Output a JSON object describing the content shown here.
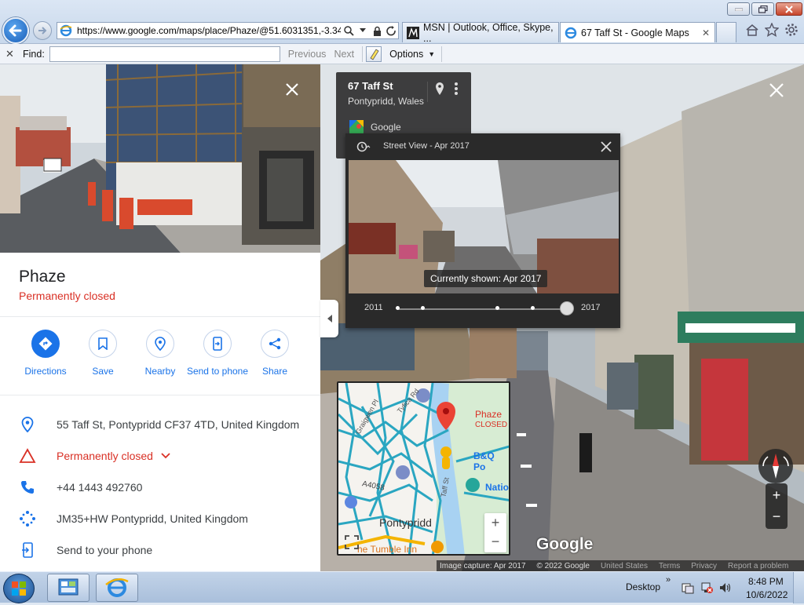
{
  "browser": {
    "address_url": "https://www.google.com/maps/place/Phaze/@51.6031351,-3.34",
    "tabs": [
      {
        "label": "MSN | Outlook, Office, Skype, ..."
      },
      {
        "label": "67 Taff St - Google Maps"
      }
    ],
    "find": {
      "label": "Find:",
      "value": "",
      "previous": "Previous",
      "next": "Next",
      "options": "Options"
    }
  },
  "place": {
    "name": "Phaze",
    "status": "Permanently closed",
    "actions": [
      {
        "label": "Directions",
        "icon": "directions-icon"
      },
      {
        "label": "Save",
        "icon": "bookmark-icon"
      },
      {
        "label": "Nearby",
        "icon": "nearby-icon"
      },
      {
        "label": "Send to phone",
        "icon": "send-to-phone-icon"
      },
      {
        "label": "Share",
        "icon": "share-icon"
      }
    ],
    "details": {
      "address": "55 Taff St, Pontypridd CF37 4TD, United Kingdom",
      "status": "Permanently closed",
      "phone": "+44 1443 492760",
      "plus_code": "JM35+HW Pontypridd, United Kingdom",
      "send_to_phone": "Send to your phone"
    }
  },
  "street_view": {
    "card": {
      "address": "67 Taff St",
      "city": "Pontypridd, Wales",
      "provider": "Google"
    },
    "time_machine": {
      "title": "Street View - Apr 2017",
      "tooltip": "Currently shown: Apr 2017",
      "start_year": "2011",
      "end_year": "2017"
    },
    "minimap": {
      "place": "Phaze",
      "place_status": "CLOSED",
      "town": "Pontypridd",
      "poi_1": "B&Q Po",
      "poi_2": "Natio",
      "road": "A4058",
      "pub": "he Tumble Inn",
      "street_1": "Tyfica Rd",
      "street_2": "Graigwen Pl",
      "street_3": "Taff St"
    },
    "watermark": "Google",
    "footer": {
      "capture": "Image capture: Apr 2017",
      "copyright": "© 2022 Google",
      "country": "United States",
      "terms": "Terms",
      "privacy": "Privacy",
      "report": "Report a problem"
    }
  },
  "taskbar": {
    "desktop_label": "Desktop",
    "time": "8:48 PM",
    "date": "10/6/2022"
  },
  "colors": {
    "accent": "#1a73e8",
    "closed": "#d93025"
  }
}
